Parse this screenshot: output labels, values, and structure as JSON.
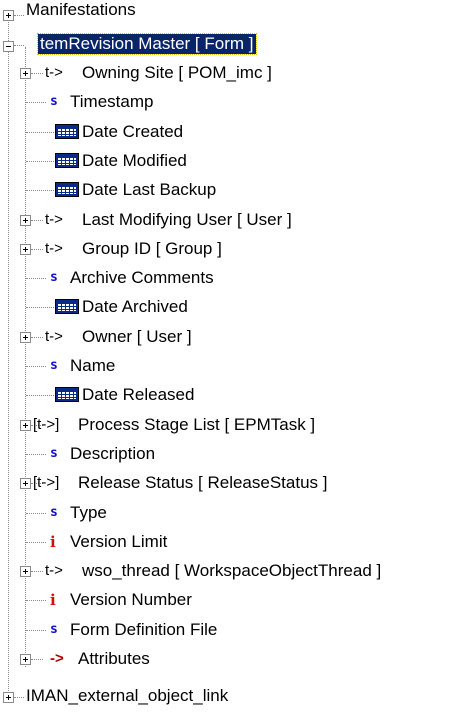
{
  "tree": {
    "top_item": {
      "label": "Manifestations"
    },
    "selected_item": {
      "label": "temRevision Master [ Form ]"
    },
    "children": [
      {
        "kind": "ref",
        "prefix": "t->",
        "label": "Owning Site [ POM_imc ]",
        "expandable": true
      },
      {
        "kind": "string",
        "prefix": "s",
        "label": "Timestamp",
        "expandable": false
      },
      {
        "kind": "date",
        "prefix": "",
        "label": "Date Created",
        "expandable": false
      },
      {
        "kind": "date",
        "prefix": "",
        "label": "Date Modified",
        "expandable": false
      },
      {
        "kind": "date",
        "prefix": "",
        "label": "Date Last Backup",
        "expandable": false
      },
      {
        "kind": "ref",
        "prefix": "t->",
        "label": "Last Modifying User [ User ]",
        "expandable": true
      },
      {
        "kind": "ref",
        "prefix": "t->",
        "label": "Group ID [ Group ]",
        "expandable": true
      },
      {
        "kind": "string",
        "prefix": "s",
        "label": "Archive Comments",
        "expandable": false
      },
      {
        "kind": "date",
        "prefix": "",
        "label": "Date Archived",
        "expandable": false
      },
      {
        "kind": "ref",
        "prefix": "t->",
        "label": "Owner [ User ]",
        "expandable": true
      },
      {
        "kind": "string",
        "prefix": "s",
        "label": "Name",
        "expandable": false
      },
      {
        "kind": "date",
        "prefix": "",
        "label": "Date Released",
        "expandable": false
      },
      {
        "kind": "reflist",
        "prefix": "[t->]",
        "label": "Process Stage List [ EPMTask ]",
        "expandable": true
      },
      {
        "kind": "string",
        "prefix": "s",
        "label": "Description",
        "expandable": false
      },
      {
        "kind": "reflist",
        "prefix": "[t->]",
        "label": "Release Status [ ReleaseStatus ]",
        "expandable": true
      },
      {
        "kind": "string",
        "prefix": "s",
        "label": "Type",
        "expandable": false
      },
      {
        "kind": "int",
        "prefix": "i",
        "label": "Version Limit",
        "expandable": false
      },
      {
        "kind": "ref",
        "prefix": "t->",
        "label": "wso_thread [ WorkspaceObjectThread ]",
        "expandable": true
      },
      {
        "kind": "int",
        "prefix": "i",
        "label": "Version Number",
        "expandable": false
      },
      {
        "kind": "string",
        "prefix": "s",
        "label": "Form Definition File",
        "expandable": false
      },
      {
        "kind": "attr",
        "prefix": "->",
        "label": "Attributes",
        "expandable": true
      }
    ],
    "bottom_item": {
      "label": "IMAN_external_object_link"
    },
    "colors": {
      "selection_bg": "#0a246a",
      "string_icon": "#1010d0",
      "int_icon": "#d01010",
      "attr_arrow": "#b00000",
      "date_icon": "#0a2a8a"
    }
  }
}
